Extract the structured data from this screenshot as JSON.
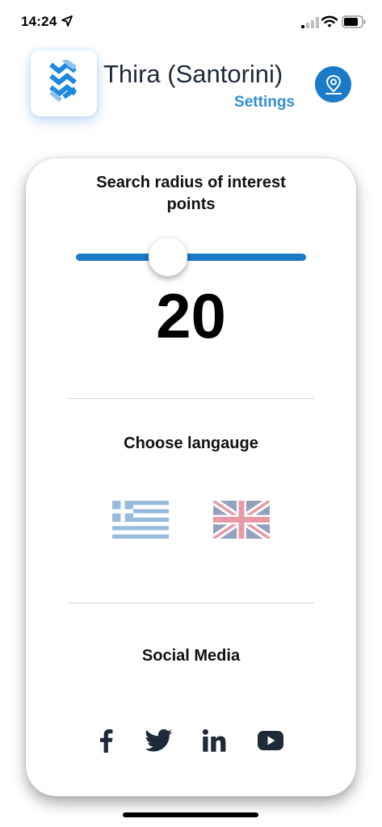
{
  "status_bar": {
    "time": "14:24",
    "icons": [
      "location-arrow-icon",
      "signal-icon",
      "wifi-icon",
      "battery-icon"
    ]
  },
  "header": {
    "title": "Thira (Santorini)",
    "subtitle": "Settings",
    "logo_icon": "zigzag-logo-icon",
    "location_button_icon": "map-pin-icon"
  },
  "search_radius": {
    "title": "Search radius of interest points",
    "value": "20",
    "slider_fraction": 0.4
  },
  "language": {
    "title": "Choose langauge",
    "options": [
      {
        "icon": "greek-flag-icon"
      },
      {
        "icon": "uk-flag-icon"
      }
    ]
  },
  "social_media": {
    "title": "Social Media",
    "icons": [
      "facebook-icon",
      "twitter-icon",
      "linkedin-icon",
      "youtube-icon"
    ]
  },
  "colors": {
    "accent": "#1b7bc9",
    "subtitle": "#2f8fd3",
    "icon_dark": "#1f2a38"
  }
}
